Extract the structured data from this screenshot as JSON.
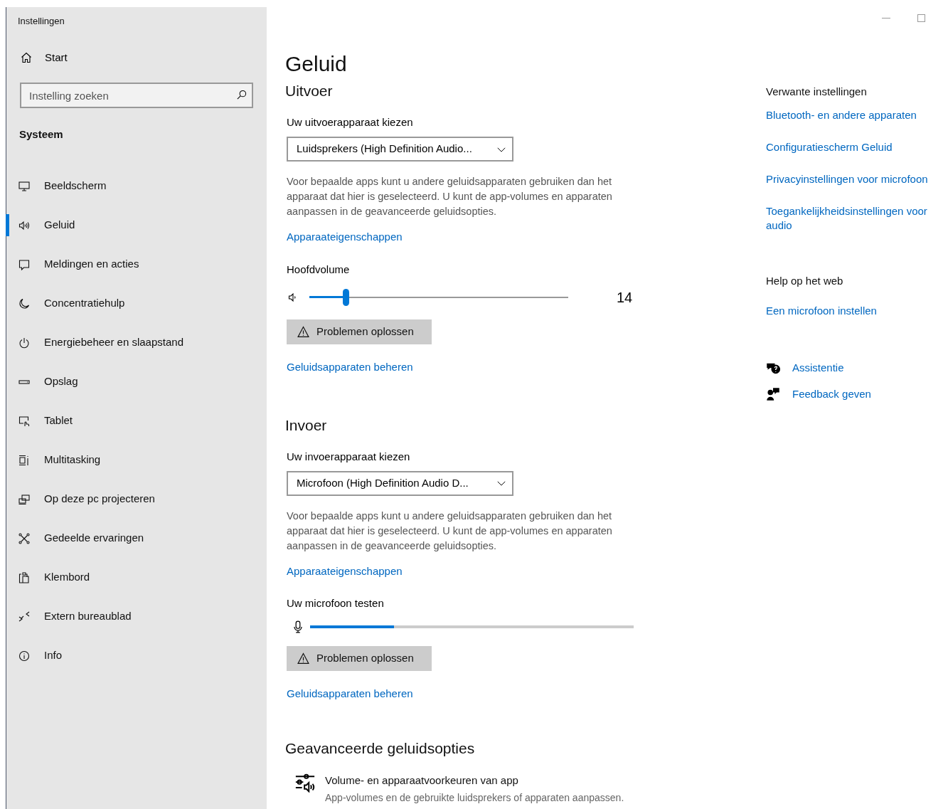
{
  "window": {
    "title": "Instellingen"
  },
  "sidebar": {
    "home": "Start",
    "search": {
      "placeholder": "Instelling zoeken"
    },
    "section": "Systeem",
    "items": [
      {
        "label": "Beeldscherm",
        "selected": false
      },
      {
        "label": "Geluid",
        "selected": true
      },
      {
        "label": "Meldingen en acties",
        "selected": false
      },
      {
        "label": "Concentratiehulp",
        "selected": false
      },
      {
        "label": "Energiebeheer en slaapstand",
        "selected": false
      },
      {
        "label": "Opslag",
        "selected": false
      },
      {
        "label": "Tablet",
        "selected": false
      },
      {
        "label": "Multitasking",
        "selected": false
      },
      {
        "label": "Op deze pc projecteren",
        "selected": false
      },
      {
        "label": "Gedeelde ervaringen",
        "selected": false
      },
      {
        "label": "Klembord",
        "selected": false
      },
      {
        "label": "Extern bureaublad",
        "selected": false
      },
      {
        "label": "Info",
        "selected": false
      }
    ]
  },
  "page": {
    "title": "Geluid",
    "output": {
      "heading": "Uitvoer",
      "device_label": "Uw uitvoerapparaat kiezen",
      "device": "Luidsprekers (High Definition Audio...",
      "description": "Voor bepaalde apps kunt u andere geluidsapparaten gebruiken dan het apparaat dat hier is geselecteerd. U kunt de app-volumes en apparaten aanpassen in de geavanceerde geluidsopties.",
      "properties_link": "Apparaateigenschappen",
      "volume_label": "Hoofdvolume",
      "volume": {
        "level": 0.14
      },
      "volume_reading": "14",
      "troubleshoot": "Problemen oplossen",
      "manage_link": "Geluidsapparaten beheren"
    },
    "input": {
      "heading": "Invoer",
      "device_label": "Uw invoerapparaat kiezen",
      "device": "Microfoon (High Definition Audio D...",
      "description": "Voor bepaalde apps kunt u andere geluidsapparaten gebruiken dan het apparaat dat hier is geselecteerd. U kunt de app-volumes en apparaten aanpassen in de geavanceerde geluidsopties.",
      "properties_link": "Apparaateigenschappen",
      "test_label": "Uw microfoon testen",
      "meter": {
        "level": 0.26
      },
      "troubleshoot": "Problemen oplossen",
      "manage_link": "Geluidsapparaten beheren"
    },
    "advanced": {
      "heading": "Geavanceerde geluidsopties",
      "items": [
        {
          "title": "Volume- en apparaatvoorkeuren van app",
          "description": "App-volumes en de gebruikte luidsprekers of apparaten aanpassen."
        }
      ]
    }
  },
  "related": {
    "heading": "Verwante instellingen",
    "links": [
      "Bluetooth- en andere apparaten",
      "Configuratiescherm Geluid",
      "Privacyinstellingen voor microfoon",
      "Toegankelijkheidsinstellingen voor audio"
    ]
  },
  "help": {
    "heading": "Help op het web",
    "links": [
      "Een microfoon instellen"
    ]
  },
  "support": [
    {
      "label": "Assistentie"
    },
    {
      "label": "Feedback geven"
    }
  ]
}
